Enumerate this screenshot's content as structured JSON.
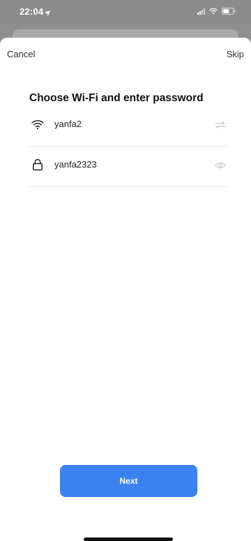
{
  "status_bar": {
    "time": "22:04",
    "location_icon": "location-arrow-icon",
    "signal_icon": "cellular-signal-icon",
    "wifi_icon": "wifi-icon",
    "battery_icon": "battery-icon"
  },
  "nav": {
    "cancel_label": "Cancel",
    "skip_label": "Skip"
  },
  "main": {
    "title": "Choose Wi-Fi and enter password",
    "ssid": {
      "value": "yanfa2",
      "leading_icon": "wifi-icon",
      "trailing_icon": "switch-network-icon"
    },
    "password": {
      "value": "yanfa2323",
      "leading_icon": "lock-icon",
      "trailing_icon": "eye-icon"
    },
    "next_label": "Next"
  },
  "colors": {
    "primary": "#3b82f0",
    "status_bar_bg": "#8c8c8c",
    "sheet_bg": "#ffffff"
  }
}
